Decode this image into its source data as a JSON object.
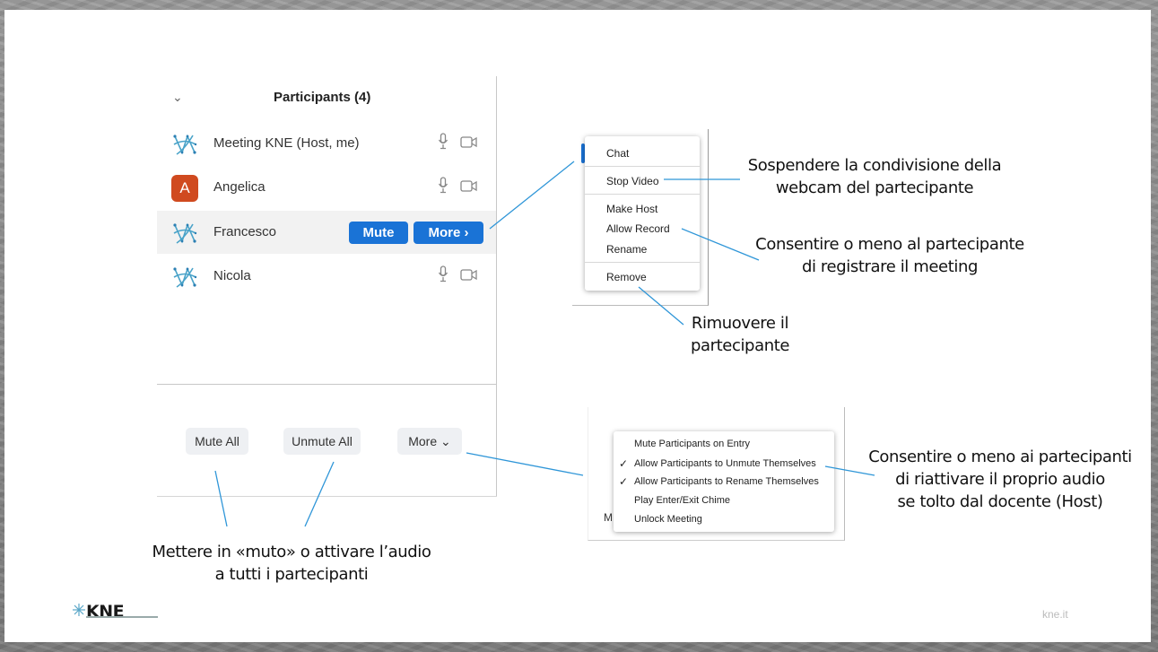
{
  "participants_panel": {
    "title": "Participants (4)",
    "collapse_glyph": "⌄",
    "participants": [
      {
        "name": "Meeting KNE (Host, me)",
        "avatar": "network-logo-icon"
      },
      {
        "name": "Angelica",
        "avatar_letter": "A",
        "avatar_color": "#d04a1f"
      },
      {
        "name": "Francesco",
        "avatar": "network-logo-icon",
        "highlighted": true
      },
      {
        "name": "Nicola",
        "avatar": "network-logo-icon"
      }
    ],
    "mute_label": "Mute",
    "more_label": "More ›",
    "footer": {
      "mute_all": "Mute All",
      "unmute_all": "Unmute All",
      "more": "More ⌄"
    }
  },
  "participant_menu": {
    "items": [
      "Chat",
      "Stop Video",
      "Make Host",
      "Allow Record",
      "Rename",
      "Remove"
    ]
  },
  "more_menu": {
    "items": [
      {
        "label": "Mute Participants on Entry",
        "checked": false
      },
      {
        "label": "Allow Participants to Unmute Themselves",
        "checked": true
      },
      {
        "label": "Allow Participants to Rename Themselves",
        "checked": true
      },
      {
        "label": "Play Enter/Exit Chime",
        "checked": false
      },
      {
        "label": "Unlock Meeting",
        "checked": false
      }
    ],
    "check_glyph": "✓",
    "partial_letter": "M"
  },
  "annotations": {
    "stop_video": [
      "Sospendere la condivisione della",
      "webcam del partecipante"
    ],
    "allow_record": [
      "Consentire o meno al partecipante",
      "di registrare il meeting"
    ],
    "remove": [
      "Rimuovere il",
      "partecipante"
    ],
    "unmute": [
      "Consentire o meno ai partecipanti",
      "di riattivare il proprio audio",
      "se tolto dal docente (Host)"
    ],
    "mute_all": [
      "Mettere in «muto» o attivare l’audio",
      "a tutti i partecipanti"
    ]
  },
  "footer": {
    "logo": "KNE",
    "site": "kne.it"
  },
  "colors": {
    "accent": "#1a73d6",
    "line": "#2f96d8"
  }
}
